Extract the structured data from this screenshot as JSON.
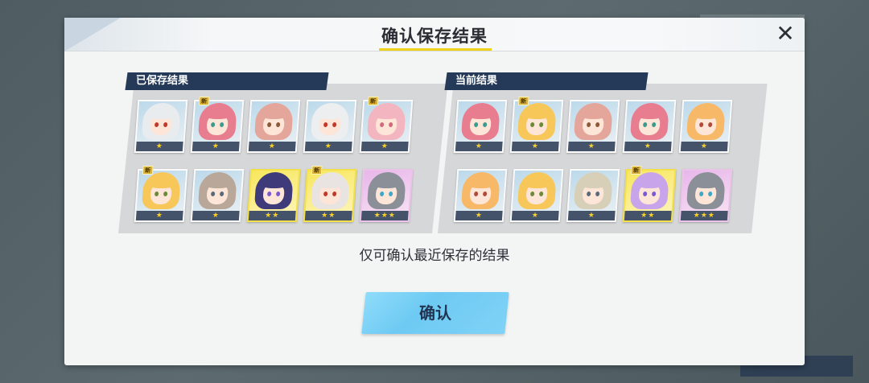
{
  "dialog": {
    "title": "确认保存结果",
    "close_icon": "close-icon",
    "notice": "仅可确认最近保存的结果",
    "confirm_label": "确认"
  },
  "saved": {
    "label": "已保存结果",
    "rows": [
      [
        {
          "stars": "★",
          "new": false,
          "rarity": "normal",
          "hair": "#e9ecef",
          "eye": "#c0392b"
        },
        {
          "stars": "★",
          "new": true,
          "new_label": "新",
          "rarity": "normal",
          "hair": "#e77d8f",
          "eye": "#3c9a8f"
        },
        {
          "stars": "★",
          "new": false,
          "rarity": "normal",
          "hair": "#e4a69a",
          "eye": "#8a5a3a"
        },
        {
          "stars": "★",
          "new": false,
          "rarity": "normal",
          "hair": "#eceef0",
          "eye": "#c0392b"
        },
        {
          "stars": "★",
          "new": true,
          "new_label": "新",
          "rarity": "normal",
          "hair": "#f3b6c0",
          "eye": "#d16a7a"
        }
      ],
      [
        {
          "stars": "★",
          "new": true,
          "new_label": "新",
          "rarity": "normal",
          "hair": "#f7c75a",
          "eye": "#6b8a3a"
        },
        {
          "stars": "★",
          "new": false,
          "rarity": "normal",
          "hair": "#b9a79a",
          "eye": "#5a6a7a"
        },
        {
          "stars": "★★",
          "new": false,
          "rarity": "rare",
          "hair": "#3f3a7a",
          "eye": "#7a5ad0"
        },
        {
          "stars": "★★",
          "new": true,
          "new_label": "新",
          "rarity": "rare",
          "hair": "#e9e4e2",
          "eye": "#c0392b"
        },
        {
          "stars": "★★★",
          "new": false,
          "rarity": "epic",
          "hair": "#8a8f98",
          "eye": "#3fa7c7"
        }
      ]
    ]
  },
  "current": {
    "label": "当前结果",
    "rows": [
      [
        {
          "stars": "★",
          "new": false,
          "rarity": "normal",
          "hair": "#e77d8f",
          "eye": "#3c9a8f"
        },
        {
          "stars": "★",
          "new": true,
          "new_label": "新",
          "rarity": "normal",
          "hair": "#f7c75a",
          "eye": "#6b8a3a"
        },
        {
          "stars": "★",
          "new": false,
          "rarity": "normal",
          "hair": "#e4a69a",
          "eye": "#8a5a3a"
        },
        {
          "stars": "★",
          "new": false,
          "rarity": "normal",
          "hair": "#e77d8f",
          "eye": "#3c9a8f"
        },
        {
          "stars": "★",
          "new": false,
          "rarity": "normal",
          "hair": "#f7b868",
          "eye": "#b04a3a"
        }
      ],
      [
        {
          "stars": "★",
          "new": false,
          "rarity": "normal",
          "hair": "#f7b868",
          "eye": "#b04a3a"
        },
        {
          "stars": "★",
          "new": false,
          "rarity": "normal",
          "hair": "#f7c75a",
          "eye": "#6b8a3a"
        },
        {
          "stars": "★",
          "new": false,
          "rarity": "normal",
          "hair": "#d8cfb8",
          "eye": "#5a6a7a"
        },
        {
          "stars": "★★",
          "new": true,
          "new_label": "新",
          "rarity": "rare",
          "hair": "#c8a5ea",
          "eye": "#7a5ad0"
        },
        {
          "stars": "★★★",
          "new": false,
          "rarity": "epic",
          "hair": "#8a8f98",
          "eye": "#3fa7c7"
        }
      ]
    ]
  }
}
